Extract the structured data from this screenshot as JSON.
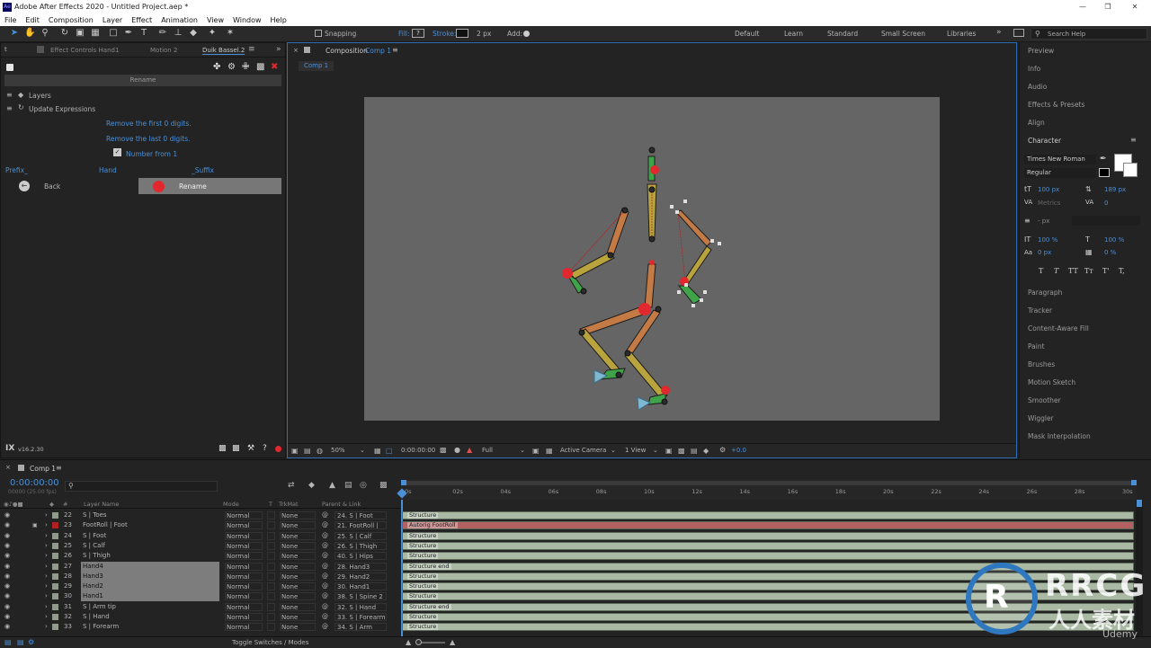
{
  "title": "Adobe After Effects 2020 - Untitled Project.aep *",
  "menu": [
    "File",
    "Edit",
    "Composition",
    "Layer",
    "Effect",
    "Animation",
    "View",
    "Window",
    "Help"
  ],
  "toolbar": {
    "snapping": "Snapping",
    "fill": "Fill:",
    "stroke": "Stroke:",
    "stroke_px": "2 px",
    "add": "Add:",
    "workspaces": [
      "Default",
      "Learn",
      "Standard",
      "Small Screen",
      "Libraries"
    ],
    "search_help": "Search Help"
  },
  "left_panel": {
    "tabs": [
      "Effect Controls Hand1",
      "Motion 2",
      "Duik Bassel.2"
    ],
    "rename_header": "Rename",
    "tree": [
      "Layers",
      "Update Expressions"
    ],
    "remove_first": "Remove the first 0 digits.",
    "remove_last": "Remove the last 0 digits.",
    "number_from": "Number from 1",
    "prefix": "Prefix_",
    "name": "Hand",
    "suffix": "_Suffix",
    "back": "Back",
    "rename_btn": "Rename",
    "version": "v16.2.30"
  },
  "comp_panel": {
    "tab_label": "Composition",
    "tab_comp": "Comp 1",
    "sub_tab": "Comp 1",
    "footer": {
      "zoom": "50%",
      "time": "0:00:00:00",
      "resolution": "Full",
      "camera": "Active Camera",
      "views": "1 View",
      "exposure": "+0.0"
    }
  },
  "right_panel": {
    "top_items": [
      "Preview",
      "Info",
      "Audio",
      "Effects & Presets",
      "Align"
    ],
    "character": {
      "title": "Character",
      "font": "Times New Roman",
      "style": "Regular",
      "size": "100 px",
      "leading": "189 px",
      "kerning": "Metrics",
      "tracking": "0",
      "stroke_w": "- px",
      "vscale": "100 %",
      "hscale": "100 %",
      "baseline": "0 px",
      "tsume": "0 %",
      "styles": [
        "T",
        "T",
        "TT",
        "Tт",
        "T'",
        "T,"
      ]
    },
    "bottom_items": [
      "Paragraph",
      "Tracker",
      "Content-Aware Fill",
      "Paint",
      "Brushes",
      "Motion Sketch",
      "Smoother",
      "Wiggler",
      "Mask Interpolation"
    ]
  },
  "timeline": {
    "tab": "Comp 1",
    "timecode": "0:00:00:00",
    "fps": "00000 (25.00 fps)",
    "columns": {
      "num": "#",
      "layer": "Layer Name",
      "mode": "Mode",
      "t": "T",
      "trkmat": "TrkMat",
      "parent": "Parent & Link"
    },
    "ruler": [
      "0s",
      "02s",
      "04s",
      "06s",
      "08s",
      "10s",
      "12s",
      "14s",
      "16s",
      "18s",
      "20s",
      "22s",
      "24s",
      "26s",
      "28s",
      "30s"
    ],
    "footer": "Toggle Switches / Modes",
    "rows": [
      {
        "num": "22",
        "name": "S | Toes",
        "mode": "Normal",
        "trk": "None",
        "parent": "24. S | Foot",
        "bar": "Structure",
        "selected": false,
        "color": "#a9b9a3"
      },
      {
        "num": "23",
        "name": "FootRoll | Foot",
        "mode": "Normal",
        "trk": "None",
        "parent": "21. FootRoll |",
        "bar": "Autorig FootRoll",
        "selected": false,
        "color": "#b26062"
      },
      {
        "num": "24",
        "name": "S | Foot",
        "mode": "Normal",
        "trk": "None",
        "parent": "25. S | Calf",
        "bar": "Structure",
        "selected": false,
        "color": "#a9b9a3"
      },
      {
        "num": "25",
        "name": "S | Calf",
        "mode": "Normal",
        "trk": "None",
        "parent": "26. S | Thigh",
        "bar": "Structure",
        "selected": false,
        "color": "#a9b9a3"
      },
      {
        "num": "26",
        "name": "S | Thigh",
        "mode": "Normal",
        "trk": "None",
        "parent": "40. S | Hips",
        "bar": "Structure",
        "selected": false,
        "color": "#a9b9a3"
      },
      {
        "num": "27",
        "name": "Hand4",
        "mode": "Normal",
        "trk": "None",
        "parent": "28. Hand3",
        "bar": "Structure end",
        "selected": true,
        "color": "#a9b9a3"
      },
      {
        "num": "28",
        "name": "Hand3",
        "mode": "Normal",
        "trk": "None",
        "parent": "29. Hand2",
        "bar": "Structure",
        "selected": true,
        "color": "#a9b9a3"
      },
      {
        "num": "29",
        "name": "Hand2",
        "mode": "Normal",
        "trk": "None",
        "parent": "30. Hand1",
        "bar": "Structure",
        "selected": true,
        "color": "#a9b9a3"
      },
      {
        "num": "30",
        "name": "Hand1",
        "mode": "Normal",
        "trk": "None",
        "parent": "38. S | Spine 2",
        "bar": "Structure",
        "selected": true,
        "color": "#a9b9a3"
      },
      {
        "num": "31",
        "name": "S | Arm tip",
        "mode": "Normal",
        "trk": "None",
        "parent": "32. S | Hand",
        "bar": "Structure end",
        "selected": false,
        "color": "#a9b9a3"
      },
      {
        "num": "32",
        "name": "S | Hand",
        "mode": "Normal",
        "trk": "None",
        "parent": "33. S | Forearm",
        "bar": "Structure",
        "selected": false,
        "color": "#a9b9a3"
      },
      {
        "num": "33",
        "name": "S | Forearm",
        "mode": "Normal",
        "trk": "None",
        "parent": "34. S | Arm",
        "bar": "Structure",
        "selected": false,
        "color": "#a9b9a3"
      }
    ]
  },
  "watermark": {
    "brand": "RRCG",
    "sub": "人人素材",
    "site": "Udemy"
  },
  "colors": {
    "accent": "#4a90d9",
    "bone_orange": "#c47a45",
    "bone_yellow": "#b8a33c",
    "bone_green": "#3fa34a",
    "ctrl_red": "#e0282e",
    "ctrl_blue": "#6aa8c8",
    "selection": "#8a8a8a"
  }
}
